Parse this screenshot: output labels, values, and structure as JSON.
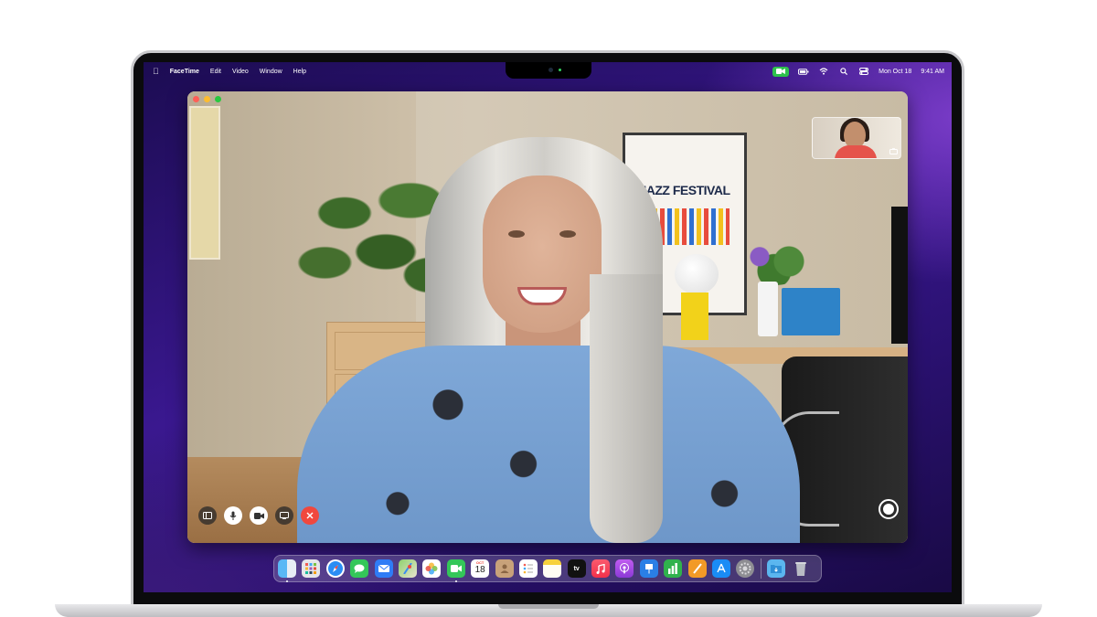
{
  "menubar": {
    "app_name": "FaceTime",
    "menus": [
      "Edit",
      "Video",
      "Window",
      "Help"
    ],
    "date": "Mon Oct 18",
    "time": "9:41 AM"
  },
  "poster": {
    "title": "JAZZ FESTIVAL"
  },
  "dock": {
    "calendar_month": "OCT",
    "calendar_day": "18",
    "tv_label": "tv",
    "apps": [
      "Finder",
      "Launchpad",
      "Safari",
      "Messages",
      "Mail",
      "Maps",
      "Photos",
      "FaceTime",
      "Calendar",
      "Contacts",
      "Reminders",
      "Notes",
      "Apple TV",
      "Music",
      "Podcasts",
      "Keynote",
      "Numbers",
      "Pages",
      "App Store",
      "System Preferences",
      "Downloads",
      "Trash"
    ]
  },
  "colors": {
    "facetime_green": "#2ec24d",
    "end_call_red": "#f0483e",
    "desktop_purple": "#3a1890"
  }
}
